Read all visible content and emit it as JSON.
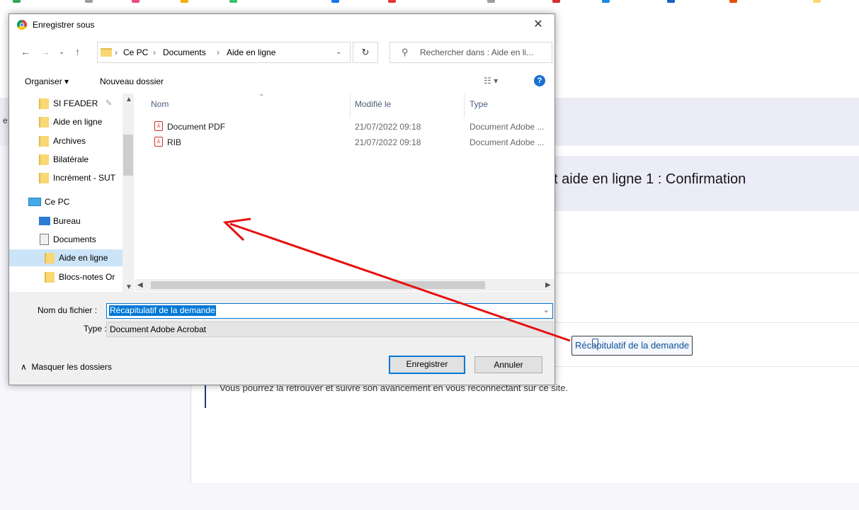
{
  "dialog": {
    "title": "Enregistrer sous",
    "close_label": "✕",
    "address": {
      "crumbs": [
        "Ce PC",
        "Documents",
        "Aide en ligne"
      ],
      "separator": "›",
      "search_placeholder": "Rechercher dans : Aide en li..."
    },
    "toolbar": {
      "organize_label": "Organiser ▾",
      "new_folder_label": "Nouveau dossier",
      "help_label": "?"
    },
    "nav_items": [
      {
        "label": "SI FEADER"
      },
      {
        "label": "Aide en ligne"
      },
      {
        "label": "Archives"
      },
      {
        "label": "Bilatérale"
      },
      {
        "label": "Incrément - SUT"
      },
      {
        "label": "Ce PC"
      },
      {
        "label": "Bureau"
      },
      {
        "label": "Documents"
      },
      {
        "label": "Aide en ligne"
      },
      {
        "label": "Blocs-notes Or"
      }
    ],
    "columns": {
      "name": "Nom",
      "modified": "Modifié le",
      "type": "Type"
    },
    "files": [
      {
        "name": "Document PDF",
        "modified": "21/07/2022 09:18",
        "type": "Document Adobe ..."
      },
      {
        "name": "RIB",
        "modified": "21/07/2022 09:18",
        "type": "Document Adobe ..."
      }
    ],
    "filename_label": "Nom du fichier :",
    "filename_value": "Récapitulatif de la demande",
    "type_label": "Type :",
    "type_value": "Document Adobe Acrobat",
    "save_label": "Enregistrer",
    "cancel_label": "Annuler",
    "hide_folders_label": "Masquer les dossiers"
  },
  "page": {
    "title_fragment": "t aide en ligne 1 : Confirmation",
    "recap_link": "Récapitulatif de la demande",
    "info_text": "Vous pourrez la retrouver et suivre son avancement en vous reconnectant sur ce site.",
    "left_fragment": "e"
  },
  "colors": {
    "accent": "#0078d7",
    "annotation_arrow": "#e81010",
    "page_band": "#ececf6",
    "link": "#0b4f9c"
  }
}
